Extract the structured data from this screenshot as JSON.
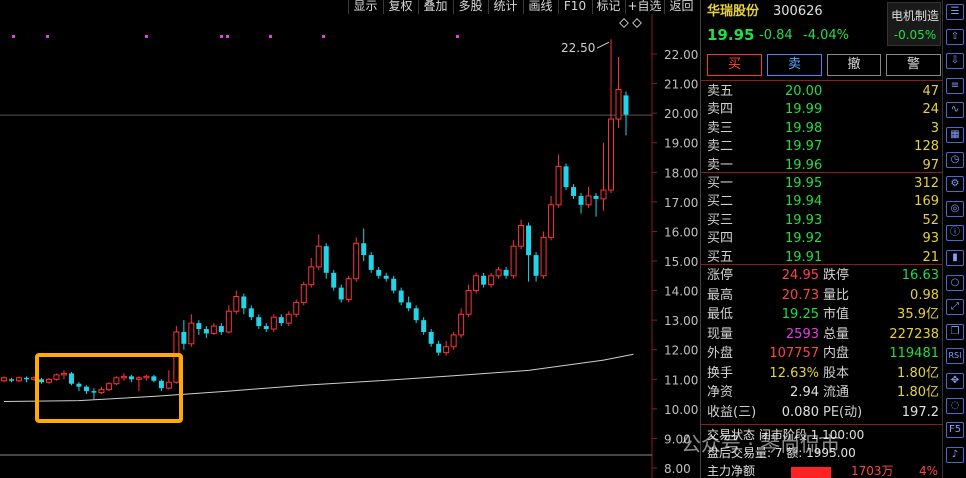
{
  "toolbar": {
    "buttons": [
      "显示",
      "复权",
      "叠加",
      "多股",
      "统计",
      "画线",
      "F10",
      "标记",
      "+自选",
      "返回"
    ]
  },
  "chart": {
    "y_ticks": [
      "22.00",
      "21.00",
      "20.00",
      "19.00",
      "18.00",
      "17.00",
      "16.00",
      "15.00",
      "14.00",
      "13.00",
      "12.00",
      "11.00",
      "10.00",
      "9.00",
      "8.00"
    ],
    "high_label": "22.50",
    "colors": {
      "up": "#ff3333",
      "down": "#22d4e6",
      "ma": "#cfcfcf",
      "highlight": "#ffaa00",
      "marker": "#e040e0"
    }
  },
  "chart_data": {
    "type": "candlestick",
    "ylim": [
      7.8,
      22.8
    ],
    "candles": [
      [
        10.95,
        11.05,
        11.1,
        10.9
      ],
      [
        11.0,
        10.95,
        11.05,
        10.9
      ],
      [
        10.95,
        11.05,
        11.1,
        10.9
      ],
      [
        11.05,
        11.0,
        11.1,
        10.9
      ],
      [
        11.0,
        11.05,
        11.1,
        10.95
      ],
      [
        11.0,
        10.9,
        11.05,
        10.85
      ],
      [
        10.9,
        11.0,
        11.05,
        10.85
      ],
      [
        11.0,
        11.15,
        11.2,
        10.95
      ],
      [
        11.15,
        11.2,
        11.3,
        11.0
      ],
      [
        11.2,
        10.85,
        11.25,
        10.8
      ],
      [
        10.85,
        10.75,
        10.9,
        10.6
      ],
      [
        10.75,
        10.6,
        10.8,
        10.5
      ],
      [
        10.6,
        10.55,
        10.7,
        10.3
      ],
      [
        10.55,
        10.65,
        10.75,
        10.5
      ],
      [
        10.65,
        10.85,
        10.9,
        10.6
      ],
      [
        10.85,
        11.05,
        11.1,
        10.8
      ],
      [
        11.05,
        11.1,
        11.2,
        10.95
      ],
      [
        11.1,
        11.0,
        11.15,
        10.9
      ],
      [
        11.0,
        11.05,
        11.1,
        10.6
      ],
      [
        11.05,
        11.1,
        11.15,
        10.95
      ],
      [
        11.1,
        10.95,
        11.15,
        10.9
      ],
      [
        10.95,
        10.7,
        11.0,
        10.6
      ],
      [
        10.7,
        10.9,
        11.3,
        10.65
      ],
      [
        10.9,
        12.6,
        12.8,
        10.85
      ],
      [
        12.6,
        12.2,
        13.0,
        12.0
      ],
      [
        12.2,
        12.9,
        13.2,
        12.1
      ],
      [
        12.9,
        12.7,
        13.0,
        12.5
      ],
      [
        12.7,
        12.55,
        12.8,
        12.4
      ],
      [
        12.55,
        12.8,
        12.9,
        12.5
      ],
      [
        12.8,
        12.6,
        12.9,
        12.5
      ],
      [
        12.6,
        13.3,
        13.5,
        12.55
      ],
      [
        13.3,
        13.8,
        14.0,
        13.2
      ],
      [
        13.8,
        13.4,
        13.9,
        13.2
      ],
      [
        13.4,
        13.1,
        13.5,
        13.0
      ],
      [
        13.1,
        12.8,
        13.2,
        12.7
      ],
      [
        12.8,
        12.7,
        12.9,
        12.6
      ],
      [
        12.7,
        13.1,
        13.2,
        12.6
      ],
      [
        13.1,
        12.9,
        13.2,
        12.8
      ],
      [
        12.9,
        13.2,
        13.3,
        12.8
      ],
      [
        13.2,
        13.6,
        13.7,
        13.1
      ],
      [
        13.6,
        14.2,
        14.3,
        13.5
      ],
      [
        14.2,
        14.8,
        15.1,
        14.1
      ],
      [
        14.8,
        15.5,
        15.9,
        14.7
      ],
      [
        15.5,
        14.6,
        15.6,
        14.4
      ],
      [
        14.6,
        14.1,
        14.7,
        14.0
      ],
      [
        14.1,
        13.7,
        14.2,
        13.6
      ],
      [
        13.7,
        14.4,
        14.5,
        13.6
      ],
      [
        14.4,
        15.6,
        15.8,
        14.3
      ],
      [
        15.6,
        15.2,
        16.1,
        15.0
      ],
      [
        15.2,
        14.7,
        15.3,
        14.6
      ],
      [
        14.7,
        14.5,
        14.8,
        14.4
      ],
      [
        14.5,
        14.4,
        14.6,
        14.3
      ],
      [
        14.4,
        14.0,
        14.5,
        13.9
      ],
      [
        14.0,
        13.6,
        14.1,
        13.5
      ],
      [
        13.6,
        13.4,
        13.8,
        13.3
      ],
      [
        13.4,
        13.0,
        13.5,
        12.9
      ],
      [
        13.0,
        12.6,
        13.1,
        12.5
      ],
      [
        12.6,
        12.2,
        12.7,
        12.1
      ],
      [
        12.2,
        11.9,
        12.3,
        11.8
      ],
      [
        11.9,
        12.1,
        12.3,
        11.8
      ],
      [
        12.1,
        12.5,
        12.6,
        12.0
      ],
      [
        12.5,
        13.2,
        13.4,
        12.4
      ],
      [
        13.2,
        14.0,
        14.2,
        13.1
      ],
      [
        14.0,
        14.5,
        14.6,
        13.9
      ],
      [
        14.5,
        14.2,
        14.6,
        14.1
      ],
      [
        14.2,
        14.5,
        14.6,
        14.1
      ],
      [
        14.5,
        14.7,
        14.8,
        14.4
      ],
      [
        14.7,
        14.5,
        14.8,
        14.4
      ],
      [
        14.5,
        15.5,
        15.7,
        14.4
      ],
      [
        15.5,
        16.2,
        16.4,
        15.4
      ],
      [
        16.2,
        15.2,
        16.3,
        14.3
      ],
      [
        15.2,
        14.5,
        15.3,
        14.3
      ],
      [
        14.5,
        15.8,
        16.0,
        14.4
      ],
      [
        15.8,
        16.9,
        17.2,
        15.7
      ],
      [
        16.9,
        18.2,
        18.6,
        16.8
      ],
      [
        18.2,
        17.5,
        18.3,
        17.4
      ],
      [
        17.5,
        17.2,
        17.6,
        17.1
      ],
      [
        17.2,
        16.9,
        17.3,
        16.6
      ],
      [
        16.9,
        17.2,
        17.5,
        16.8
      ],
      [
        17.2,
        17.1,
        17.3,
        16.5
      ],
      [
        17.1,
        17.4,
        19.0,
        16.7
      ],
      [
        17.4,
        19.8,
        22.5,
        17.3
      ],
      [
        19.8,
        20.8,
        21.9,
        19.5
      ],
      [
        20.6,
        19.95,
        20.73,
        19.25
      ]
    ],
    "ma": [
      [
        0,
        10.25
      ],
      [
        10,
        10.28
      ],
      [
        20,
        10.42
      ],
      [
        30,
        10.6
      ],
      [
        40,
        10.8
      ],
      [
        50,
        10.95
      ],
      [
        60,
        11.12
      ],
      [
        70,
        11.3
      ],
      [
        80,
        11.65
      ],
      [
        84,
        11.85
      ]
    ]
  },
  "stock": {
    "name": "华瑞股份",
    "code": "300626",
    "price": "19.95",
    "change": "-0.84",
    "change_pct": "-4.04%",
    "sector_name": "电机制造",
    "sector_change": "-0.05%"
  },
  "actions": {
    "buy": "买",
    "sell": "卖",
    "cancel": "撤",
    "alert": "警"
  },
  "asks": [
    {
      "label": "卖五",
      "price": "20.00",
      "vol": "47"
    },
    {
      "label": "卖四",
      "price": "19.99",
      "vol": "24"
    },
    {
      "label": "卖三",
      "price": "19.98",
      "vol": "3"
    },
    {
      "label": "卖二",
      "price": "19.97",
      "vol": "128"
    },
    {
      "label": "卖一",
      "price": "19.96",
      "vol": "97"
    }
  ],
  "bids": [
    {
      "label": "买一",
      "price": "19.95",
      "vol": "312"
    },
    {
      "label": "买二",
      "price": "19.94",
      "vol": "169"
    },
    {
      "label": "买三",
      "price": "19.93",
      "vol": "52"
    },
    {
      "label": "买四",
      "price": "19.92",
      "vol": "93"
    },
    {
      "label": "买五",
      "price": "19.91",
      "vol": "21"
    }
  ],
  "stats": {
    "limit_up_label": "涨停",
    "limit_up": "24.95",
    "limit_down_label": "跌停",
    "limit_down": "16.63",
    "high_label": "最高",
    "high": "20.73",
    "vol_ratio_label": "量比",
    "vol_ratio": "0.98",
    "low_label": "最低",
    "low": "19.25",
    "mkt_cap_label": "市值",
    "mkt_cap": "35.9亿",
    "current_vol_label": "现量",
    "current_vol": "2593",
    "total_vol_label": "总量",
    "total_vol": "227238",
    "outer_label": "外盘",
    "outer": "107757",
    "inner_label": "内盘",
    "inner": "119481",
    "turnover_label": "换手",
    "turnover": "12.63%",
    "share_cap_label": "股本",
    "share_cap": "1.80亿",
    "net_asset_label": "净资",
    "net_asset": "2.94",
    "float_label": "流通",
    "float": "1.80亿",
    "eps_label": "收益(三)",
    "eps": "0.080",
    "pe_label": "PE(动)",
    "pe": "197.2"
  },
  "footer": {
    "line1": "交易状态 闭市阶段 1.100:00",
    "line2": "盘后交易量: 7  额: 1995.00",
    "line3_label": "主力净额",
    "line3_value": "1703万",
    "line3_pct": "4%",
    "watermark": "公众号 · 琴尚侃市"
  },
  "side_icons": [
    "menu-icon",
    "up-icon",
    "down-icon",
    "list-icon",
    "line-chart-icon",
    "grid-icon",
    "clock-icon",
    "gear-icon",
    "target-icon",
    "info-icon",
    "bar-icon",
    "circle-icon",
    "expand-icon",
    "copy-icon",
    "rsi-icon",
    "move-icon",
    "circle2-icon",
    "f5-icon",
    "bell-icon"
  ],
  "side_labels": {
    "rsi": "RSI",
    "f5": "F5"
  }
}
